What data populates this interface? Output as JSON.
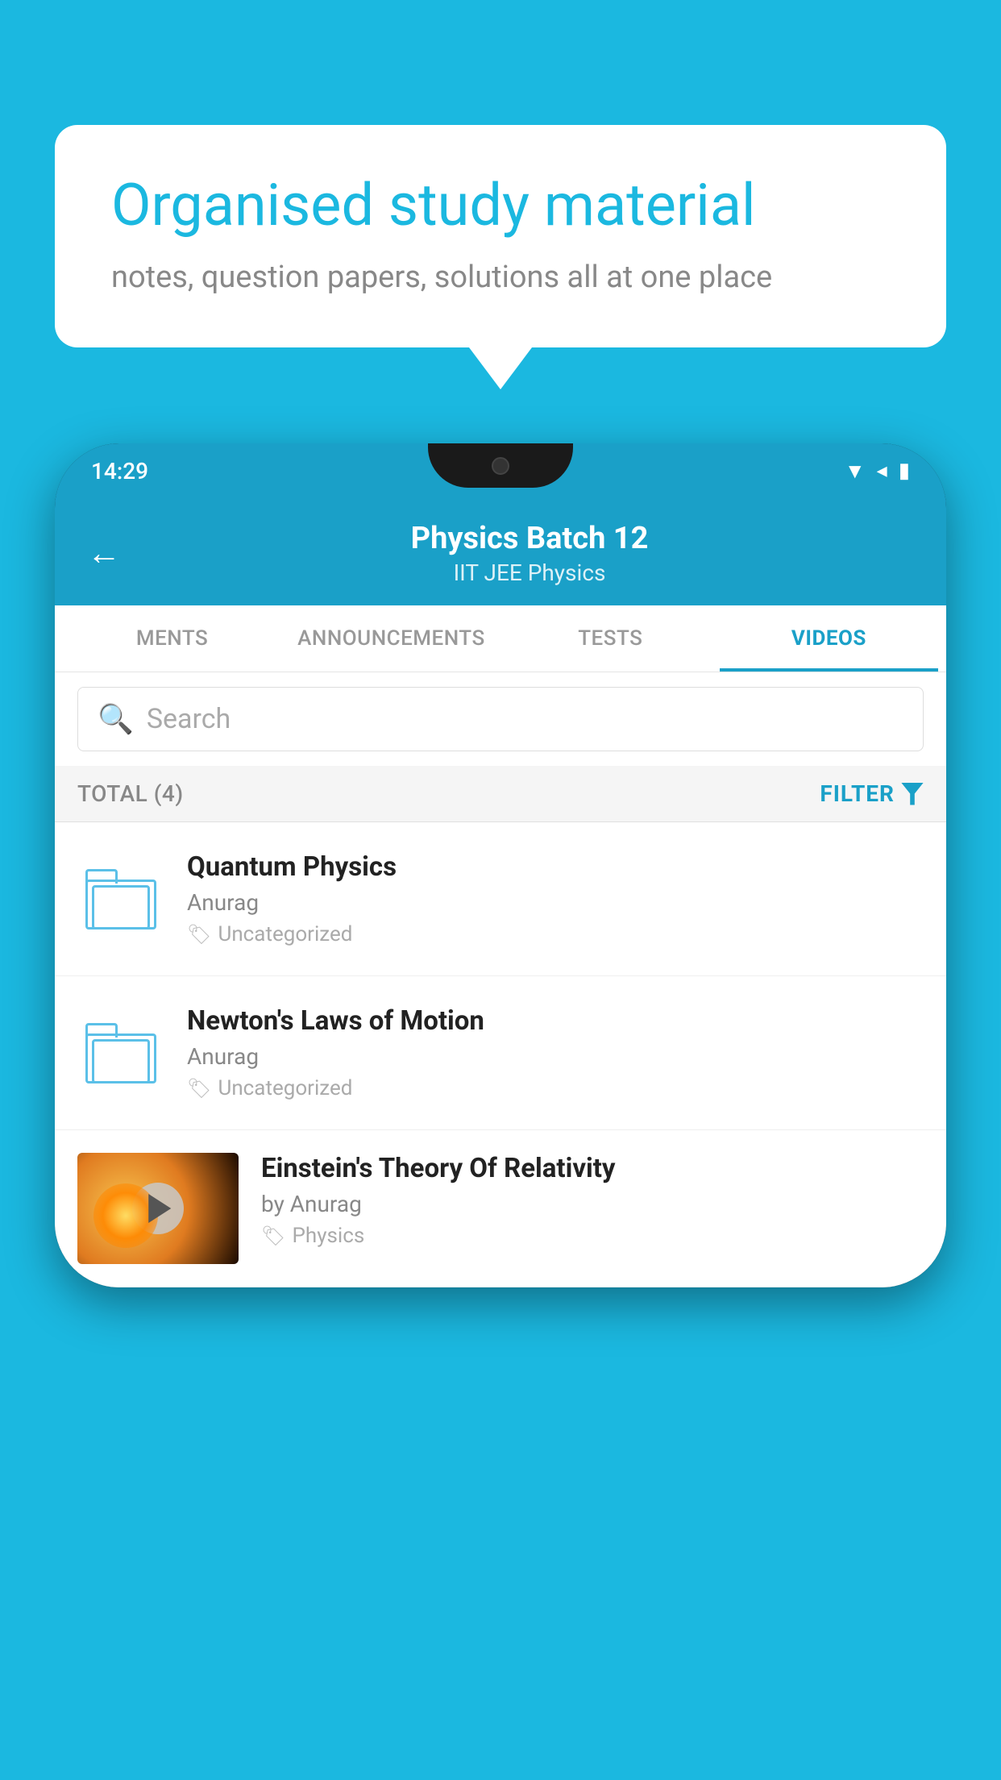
{
  "bubble": {
    "title": "Organised study material",
    "subtitle": "notes, question papers, solutions all at one place"
  },
  "phone": {
    "status": {
      "time": "14:29"
    },
    "header": {
      "back_label": "←",
      "title": "Physics Batch 12",
      "subtitle": "IIT JEE   Physics"
    },
    "tabs": [
      {
        "label": "MENTS",
        "active": false
      },
      {
        "label": "ANNOUNCEMENTS",
        "active": false
      },
      {
        "label": "TESTS",
        "active": false
      },
      {
        "label": "VIDEOS",
        "active": true
      }
    ],
    "search": {
      "placeholder": "Search"
    },
    "filter": {
      "total_label": "TOTAL (4)",
      "filter_label": "FILTER"
    },
    "videos": [
      {
        "id": 1,
        "title": "Quantum Physics",
        "author": "Anurag",
        "tag": "Uncategorized",
        "type": "folder"
      },
      {
        "id": 2,
        "title": "Newton's Laws of Motion",
        "author": "Anurag",
        "tag": "Uncategorized",
        "type": "folder"
      },
      {
        "id": 3,
        "title": "Einstein's Theory Of Relativity",
        "author": "by Anurag",
        "tag": "Physics",
        "type": "video"
      }
    ]
  }
}
